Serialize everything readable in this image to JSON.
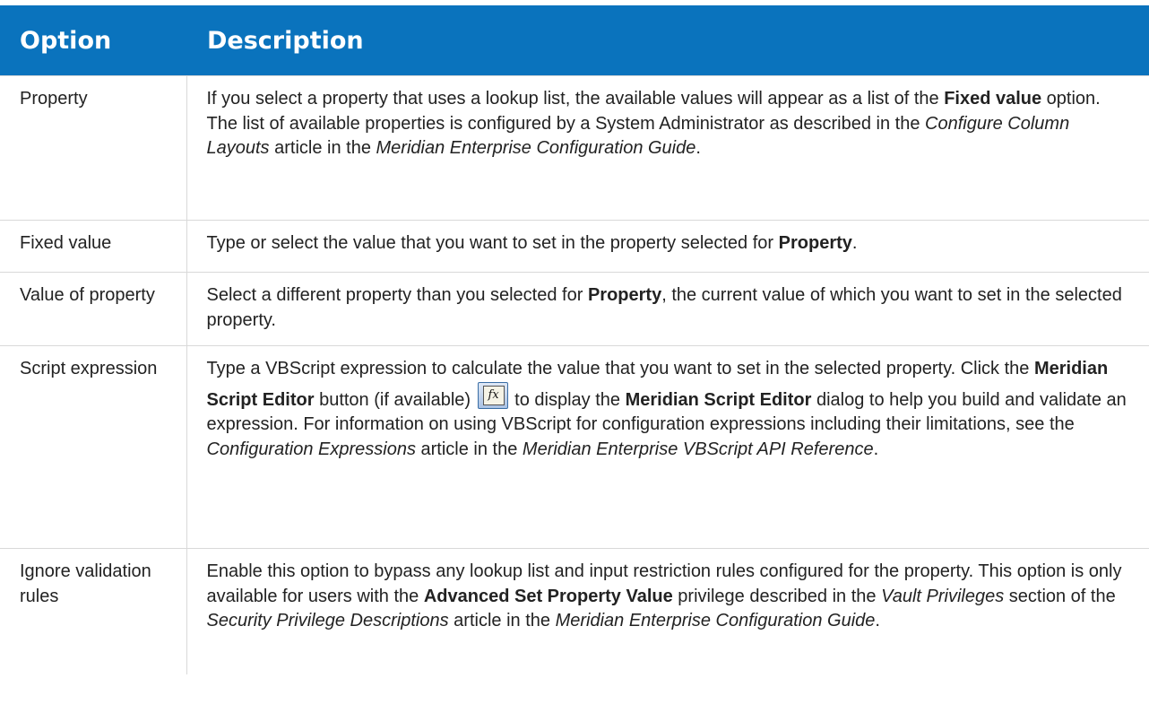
{
  "table": {
    "headers": {
      "option": "Option",
      "description": "Description"
    },
    "rows": [
      {
        "option": "Property",
        "desc": {
          "t1": "If you select a property that uses a lookup list, the available values will appear as a list of the ",
          "b1": "Fixed value",
          "t2": " option. The list of available properties is configured by a System Administrator as described in the ",
          "i1": "Configure Column Layouts",
          "t3": " article in the ",
          "i2": "Meridian Enterprise Configuration Guide",
          "t4": "."
        }
      },
      {
        "option": "Fixed value",
        "desc": {
          "t1": "Type or select the value that you want to set in the property selected for ",
          "b1": "Property",
          "t2": "."
        }
      },
      {
        "option": "Value of property",
        "desc": {
          "t1": "Select a different property than you selected for ",
          "b1": "Property",
          "t2": ", the current value of which you want to set in the selected property."
        }
      },
      {
        "option": "Script expression",
        "desc": {
          "t1": "Type a VBScript expression to calculate the value that you want to set in the selected property. Click the ",
          "b1": "Meridian Script Editor",
          "t2": " button (if available) ",
          "t3": " to display the ",
          "b2": "Meridian Script Editor",
          "t4": " dialog to help you build and validate an expression.  For information on using VBScript for configuration expressions including their limitations, see the ",
          "i1": "Configuration Expressions",
          "t5": " article in the ",
          "i2": "Meridian Enterprise VBScript API Reference",
          "t6": "."
        },
        "icon": "fx-script-editor-icon"
      },
      {
        "option": "Ignore validation rules",
        "desc": {
          "t1": "Enable this option to bypass any lookup list and input restriction rules configured for the property. This option is only available for users with the ",
          "b1": "Advanced Set Property Value",
          "t2": " privilege described in the ",
          "i1": "Vault Privileges",
          "t3": " section of the ",
          "i2": "Security Privilege Descriptions",
          "t4": " article in the ",
          "i3": "Meridian Enterprise Configuration Guide",
          "t5": "."
        }
      }
    ]
  },
  "colors": {
    "header_bg": "#0a73bd",
    "header_text": "#ffffff",
    "border": "#d9d9d9"
  }
}
